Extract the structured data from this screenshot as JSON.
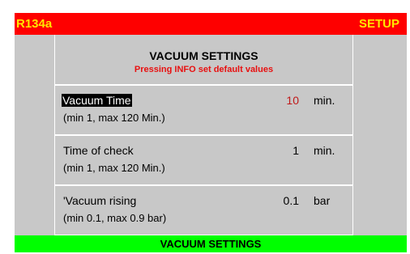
{
  "topbar": {
    "refrigerant": "R134a",
    "mode": "SETUP"
  },
  "panel": {
    "title": "VACUUM SETTINGS",
    "subtitle": "Pressing INFO set default values"
  },
  "rows": [
    {
      "label": "Vacuum Time",
      "range": "(min 1, max 120 Min.)",
      "value": "10",
      "unit": "min."
    },
    {
      "label": "Time of check",
      "range": "(min 1, max 120 Min.)",
      "value": "1",
      "unit": "min."
    },
    {
      "label": "'Vacuum rising",
      "range": "(min 0.1, max 0.9 bar)",
      "value": "0.1",
      "unit": "bar"
    }
  ],
  "footer": {
    "label": "VACUUM SETTINGS"
  },
  "colors": {
    "topbar": "#fe0000",
    "topbar_text": "#ffe600",
    "panel": "#c8c8c8",
    "active_value": "#c01818",
    "subtitle": "#e81010",
    "footer": "#00ff00"
  }
}
